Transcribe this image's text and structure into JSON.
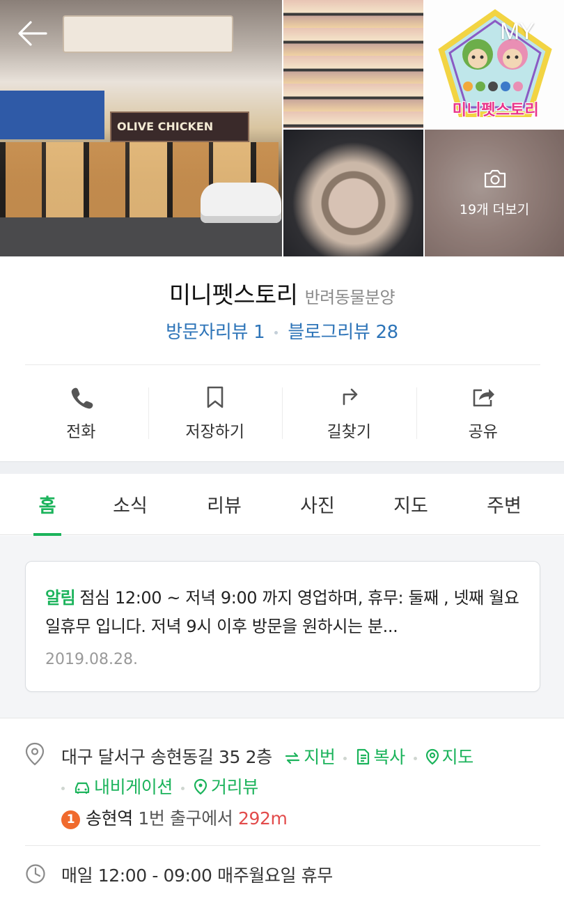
{
  "header": {
    "my_label": "MY"
  },
  "gallery": {
    "store_sign_text": "OLIVE CHICKEN",
    "logo_text": "미니펫스토리",
    "more_label": "19개 더보기"
  },
  "place": {
    "name": "미니펫스토리",
    "category": "반려동물분양",
    "visitor_reviews": "방문자리뷰 1",
    "blog_reviews": "블로그리뷰 28"
  },
  "actions": [
    {
      "label": "전화",
      "icon": "phone-icon"
    },
    {
      "label": "저장하기",
      "icon": "bookmark-icon"
    },
    {
      "label": "길찾기",
      "icon": "directions-icon"
    },
    {
      "label": "공유",
      "icon": "share-icon"
    }
  ],
  "tabs": [
    {
      "label": "홈",
      "active": true
    },
    {
      "label": "소식",
      "active": false
    },
    {
      "label": "리뷰",
      "active": false
    },
    {
      "label": "사진",
      "active": false
    },
    {
      "label": "지도",
      "active": false
    },
    {
      "label": "주변",
      "active": false
    }
  ],
  "notice": {
    "tag": "알림",
    "text": "점심 12:00 ~ 저녁 9:00 까지 영업하며,  휴무: 둘째 , 넷째 월요일휴무 입니다.  저녁 9시 이후 방문을 원하시는 분...",
    "date": "2019.08.28."
  },
  "info": {
    "address": "대구 달서구 송현동길 35 2층",
    "lot_number_label": "지번",
    "copy_label": "복사",
    "map_label": "지도",
    "navigation_label": "내비게이션",
    "street_view_label": "거리뷰",
    "subway_line": "1",
    "station": "송현역",
    "exit_text": "1번 출구에서",
    "distance": "292m",
    "hours": "매일 12:00 - 09:00 매주월요일 휴무"
  },
  "colors": {
    "accent_green": "#1bb35b",
    "review_blue": "#2d74b8",
    "distance_red": "#e24b4b",
    "subway_line_1": "#f06a2d"
  }
}
